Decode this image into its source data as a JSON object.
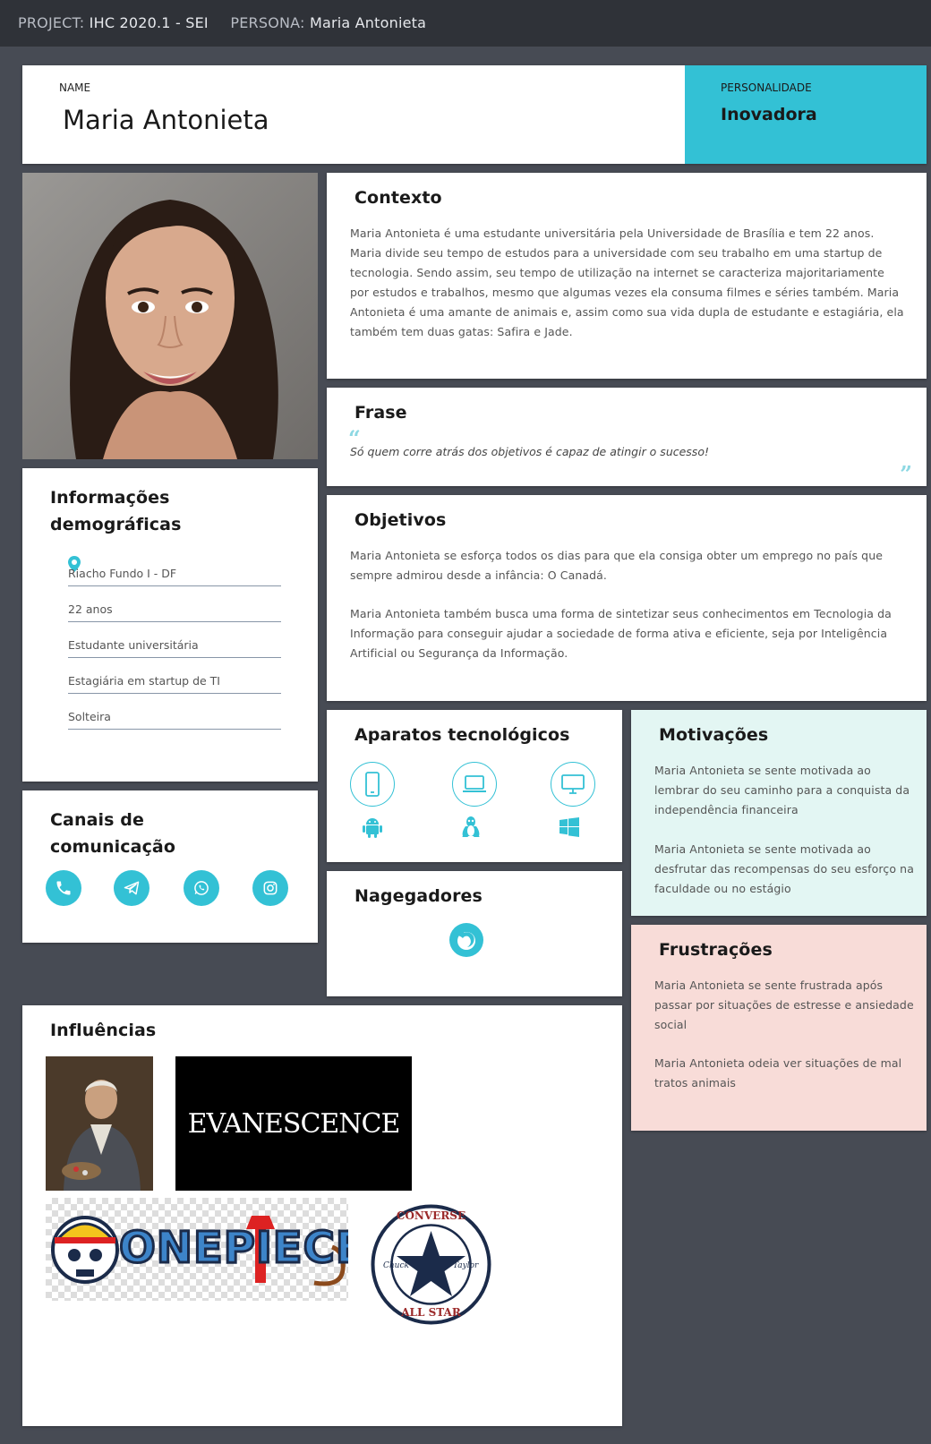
{
  "topbar": {
    "project_label": "PROJECT:",
    "project_value": "IHC 2020.1 - SEI",
    "persona_label": "PERSONA:",
    "persona_value": "Maria Antonieta"
  },
  "header": {
    "name_label": "NAME",
    "name": "Maria Antonieta",
    "personality_label": "PERSONALIDADE",
    "personality": "Inovadora"
  },
  "photo": {
    "alt": "avatar photo"
  },
  "demographics": {
    "title": "Informações demográficas",
    "items": [
      "Riacho Fundo I - DF",
      "22 anos",
      "Estudante universitária",
      "Estagiária em startup de TI",
      "Solteira"
    ]
  },
  "channels": {
    "title": "Canais de comunicação",
    "icons": [
      "phone-icon",
      "telegram-icon",
      "whatsapp-icon",
      "instagram-icon"
    ]
  },
  "context": {
    "title": "Contexto",
    "text": "Maria Antonieta é uma estudante universitária pela Universidade de Brasília e tem 22 anos. Maria divide seu tempo de estudos para a universidade com seu trabalho em uma startup de tecnologia. Sendo assim, seu tempo de utilização na internet se caracteriza majoritariamente por estudos e trabalhos, mesmo que algumas vezes ela consuma filmes e séries também. Maria Antonieta é uma amante de animais e, assim como sua vida dupla de estudante e estagiária, ela também tem duas gatas: Safira e Jade."
  },
  "phrase": {
    "title": "Frase",
    "text": "Só quem corre atrás dos objetivos é capaz de atingir o sucesso!",
    "open_quote": "“",
    "close_quote": "”"
  },
  "goals": {
    "title": "Objetivos",
    "p1": "Maria Antonieta se esforça todos os dias para que ela consiga obter um emprego no país que sempre admirou desde a infância: O Canadá.",
    "p2": "Maria Antonieta também busca uma forma de sintetizar seus conhecimentos em Tecnologia da Informação para conseguir ajudar a sociedade de forma ativa e eficiente, seja por Inteligência Artificial ou Segurança da Informação."
  },
  "devices": {
    "title": "Aparatos tecnológicos",
    "icons": [
      "smartphone-icon",
      "laptop-icon",
      "desktop-icon",
      "android-icon",
      "linux-icon",
      "windows-icon"
    ]
  },
  "browsers": {
    "title": "Nagegadores",
    "icons": [
      "firefox-icon"
    ]
  },
  "motivations": {
    "title": "Motivações",
    "p1": "Maria Antonieta se sente motivada ao lembrar do seu caminho para a conquista da independência financeira",
    "p2": "Maria Antonieta se sente motivada ao desfrutar das recompensas do seu esforço na faculdade ou no estágio"
  },
  "frustrations": {
    "title": "Frustrações",
    "p1": "Maria Antonieta se sente frustrada após passar por situações de estresse e ansiedade social",
    "p2": "Maria Antonieta odeia ver situações de mal tratos animais"
  },
  "influences": {
    "title": "Influências",
    "evanescence": "EVANESCENCE",
    "onepiece": "ONEPIECE",
    "converse_top": "CONVERSE",
    "converse_mid_left": "Chuck",
    "converse_mid_right": "Taylor",
    "converse_bottom": "ALL STAR"
  },
  "colors": {
    "accent": "#33c1d5",
    "background": "#474b54",
    "topbar": "#2f3238",
    "motivations_bg": "#e3f6f3",
    "frustrations_bg": "#f8dcd8"
  }
}
